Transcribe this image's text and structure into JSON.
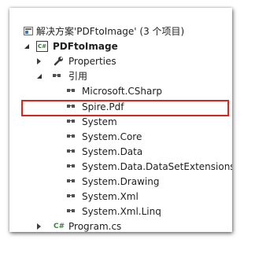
{
  "solution_explorer": {
    "solution_label": "解决方案'PDFtoImage' (3 个项目)",
    "project_label": "PDFtoImage",
    "properties_label": "Properties",
    "references_label": "引用",
    "references": [
      "Microsoft.CSharp",
      "Spire.Pdf",
      "System",
      "System.Core",
      "System.Data",
      "System.Data.DataSetExtensions",
      "System.Drawing",
      "System.Xml",
      "System.Xml.Linq"
    ],
    "program_file_label": "Program.cs",
    "cs_glyph": "C#",
    "highlighted_reference": "Spire.Pdf",
    "highlight_color": "#d9251b"
  }
}
